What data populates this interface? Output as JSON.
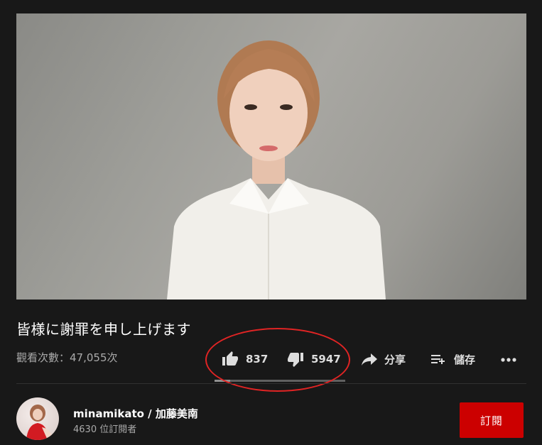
{
  "video": {
    "title": "皆様に謝罪を申し上げます",
    "views": "觀看次數：47,055次"
  },
  "actions": {
    "like_count": "837",
    "dislike_count": "5947",
    "share_label": "分享",
    "save_label": "儲存",
    "like_ratio": 0.12
  },
  "channel": {
    "name": "minamikato / 加藤美南",
    "subscribers": "4630 位訂閱者",
    "subscribe_label": "訂閱"
  },
  "colors": {
    "subscribe": "#cc0000",
    "annotation_ring": "#e02424",
    "background": "#181818"
  },
  "icons": [
    "thumbs-up-icon",
    "thumbs-down-icon",
    "share-icon",
    "save-playlist-icon",
    "more-icon"
  ]
}
